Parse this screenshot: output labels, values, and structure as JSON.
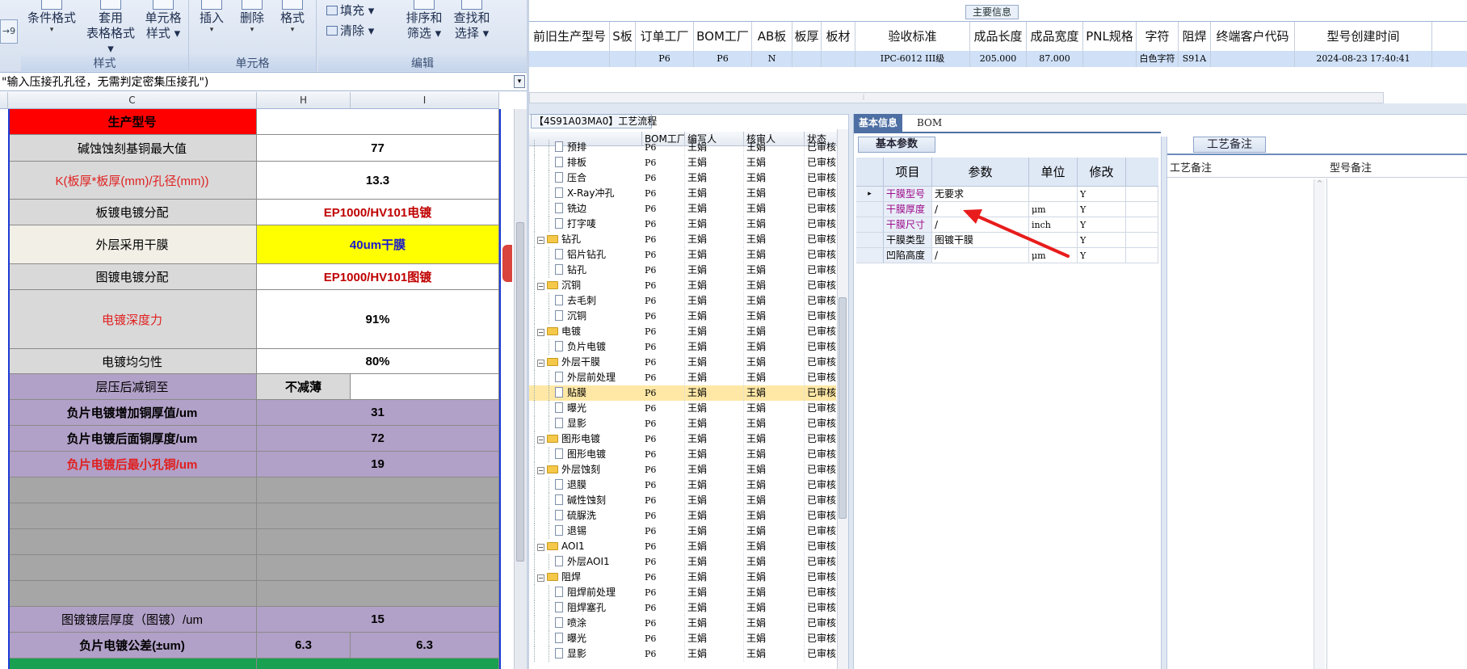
{
  "ribbon": {
    "cond_format": "条件格式",
    "table_format_1": "套用",
    "table_format_2": "表格格式",
    "cell_style_1": "单元格",
    "cell_style_2": "样式",
    "group_style": "样式",
    "insert": "插入",
    "delete": "删除",
    "format": "格式",
    "group_cells": "单元格",
    "fill": "填充",
    "clear": "清除",
    "sort_1": "排序和",
    "sort_2": "筛选",
    "find_1": "查找和",
    "find_2": "选择",
    "group_edit": "编辑"
  },
  "formula_bar": {
    "text": "\"输入压接孔孔径，无需判定密集压接孔\")"
  },
  "columns": {
    "c": "C",
    "h": "H",
    "i": "I"
  },
  "sheet": {
    "r1_label": "生产型号",
    "r2_label": "碱蚀蚀刻基铜最大值",
    "r2_value": "77",
    "r3_label": "K(板厚*板厚(mm)/孔径(mm))",
    "r3_value": "13.3",
    "r4_label": "板镀电镀分配",
    "r4_value": "EP1000/HV101电镀",
    "r5_label": "外层采用干膜",
    "r5_value": "40um干膜",
    "r6_label": "图镀电镀分配",
    "r6_value": "EP1000/HV101图镀",
    "r7_label": "电镀深度力",
    "r7_value": "91%",
    "r8_label": "电镀均匀性",
    "r8_value": "80%",
    "r9_label": "层压后减铜至",
    "r9_value": "不减薄",
    "r10_label": "负片电镀增加铜厚值/um",
    "r10_value": "31",
    "r11_label": "负片电镀后面铜厚度/um",
    "r11_value": "72",
    "r12_label": "负片电镀后最小孔铜/um",
    "r12_value": "19",
    "r13_label": "图镀镀层厚度（图镀）/um",
    "r13_value": "15",
    "r14_label": "负片电镀公差(±um)",
    "r14_value_h": "6.3",
    "r14_value_i": "6.3"
  },
  "main_info_tab": "主要信息",
  "top_grid": {
    "headers": [
      "前旧生产型号",
      "S板",
      "订单工厂",
      "BOM工厂",
      "AB板",
      "板厚",
      "板材",
      "验收标准",
      "成品长度",
      "成品宽度",
      "PNL规格",
      "字符",
      "阻焊",
      "终端客户代码",
      "型号创建时间"
    ],
    "row": [
      "",
      "",
      "P6",
      "P6",
      "N",
      "",
      "",
      "IPC-6012 III级",
      "205.000",
      "87.000",
      "",
      "白色字符",
      "S91A",
      "",
      "2024-08-23 17:40:41"
    ]
  },
  "tree": {
    "tab_title": "【4S91A03MA0】工艺流程",
    "headers": {
      "bom": "BOM工厂",
      "author": "编写人",
      "reviewer": "核审人",
      "status": "状态"
    },
    "rows": [
      {
        "name": "预排",
        "level": 2,
        "folder": false,
        "bom": "P6",
        "author": "王娟",
        "reviewer": "王娟",
        "status": "已审核"
      },
      {
        "name": "排板",
        "level": 2,
        "folder": false,
        "bom": "P6",
        "author": "王娟",
        "reviewer": "王娟",
        "status": "已审核"
      },
      {
        "name": "压合",
        "level": 2,
        "folder": false,
        "bom": "P6",
        "author": "王娟",
        "reviewer": "王娟",
        "status": "已审核"
      },
      {
        "name": "X-Ray冲孔",
        "level": 2,
        "folder": false,
        "bom": "P6",
        "author": "王娟",
        "reviewer": "王娟",
        "status": "已审核"
      },
      {
        "name": "铣边",
        "level": 2,
        "folder": false,
        "bom": "P6",
        "author": "王娟",
        "reviewer": "王娟",
        "status": "已审核"
      },
      {
        "name": "打字唛",
        "level": 2,
        "folder": false,
        "bom": "P6",
        "author": "王娟",
        "reviewer": "王娟",
        "status": "已审核"
      },
      {
        "name": "钻孔",
        "level": 1,
        "folder": true,
        "bom": "P6",
        "author": "王娟",
        "reviewer": "王娟",
        "status": "已审核"
      },
      {
        "name": "铝片钻孔",
        "level": 2,
        "folder": false,
        "bom": "P6",
        "author": "王娟",
        "reviewer": "王娟",
        "status": "已审核"
      },
      {
        "name": "钻孔",
        "level": 2,
        "folder": false,
        "bom": "P6",
        "author": "王娟",
        "reviewer": "王娟",
        "status": "已审核"
      },
      {
        "name": "沉铜",
        "level": 1,
        "folder": true,
        "bom": "P6",
        "author": "王娟",
        "reviewer": "王娟",
        "status": "已审核"
      },
      {
        "name": "去毛刺",
        "level": 2,
        "folder": false,
        "bom": "P6",
        "author": "王娟",
        "reviewer": "王娟",
        "status": "已审核"
      },
      {
        "name": "沉铜",
        "level": 2,
        "folder": false,
        "bom": "P6",
        "author": "王娟",
        "reviewer": "王娟",
        "status": "已审核"
      },
      {
        "name": "电镀",
        "level": 1,
        "folder": true,
        "bom": "P6",
        "author": "王娟",
        "reviewer": "王娟",
        "status": "已审核"
      },
      {
        "name": "负片电镀",
        "level": 2,
        "folder": false,
        "bom": "P6",
        "author": "王娟",
        "reviewer": "王娟",
        "status": "已审核"
      },
      {
        "name": "外层干膜",
        "level": 1,
        "folder": true,
        "bom": "P6",
        "author": "王娟",
        "reviewer": "王娟",
        "status": "已审核"
      },
      {
        "name": "外层前处理",
        "level": 2,
        "folder": false,
        "bom": "P6",
        "author": "王娟",
        "reviewer": "王娟",
        "status": "已审核"
      },
      {
        "name": "贴膜",
        "level": 2,
        "folder": false,
        "bom": "P6",
        "author": "王娟",
        "reviewer": "王娟",
        "status": "已审核",
        "selected": true
      },
      {
        "name": "曝光",
        "level": 2,
        "folder": false,
        "bom": "P6",
        "author": "王娟",
        "reviewer": "王娟",
        "status": "已审核"
      },
      {
        "name": "显影",
        "level": 2,
        "folder": false,
        "bom": "P6",
        "author": "王娟",
        "reviewer": "王娟",
        "status": "已审核"
      },
      {
        "name": "图形电镀",
        "level": 1,
        "folder": true,
        "bom": "P6",
        "author": "王娟",
        "reviewer": "王娟",
        "status": "已审核"
      },
      {
        "name": "图形电镀",
        "level": 2,
        "folder": false,
        "bom": "P6",
        "author": "王娟",
        "reviewer": "王娟",
        "status": "已审核"
      },
      {
        "name": "外层蚀刻",
        "level": 1,
        "folder": true,
        "bom": "P6",
        "author": "王娟",
        "reviewer": "王娟",
        "status": "已审核"
      },
      {
        "name": "退膜",
        "level": 2,
        "folder": false,
        "bom": "P6",
        "author": "王娟",
        "reviewer": "王娟",
        "status": "已审核"
      },
      {
        "name": "碱性蚀刻",
        "level": 2,
        "folder": false,
        "bom": "P6",
        "author": "王娟",
        "reviewer": "王娟",
        "status": "已审核"
      },
      {
        "name": "硫脲洗",
        "level": 2,
        "folder": false,
        "bom": "P6",
        "author": "王娟",
        "reviewer": "王娟",
        "status": "已审核"
      },
      {
        "name": "退锡",
        "level": 2,
        "folder": false,
        "bom": "P6",
        "author": "王娟",
        "reviewer": "王娟",
        "status": "已审核"
      },
      {
        "name": "AOI1",
        "level": 1,
        "folder": true,
        "bom": "P6",
        "author": "王娟",
        "reviewer": "王娟",
        "status": "已审核"
      },
      {
        "name": "外层AOI1",
        "level": 2,
        "folder": false,
        "bom": "P6",
        "author": "王娟",
        "reviewer": "王娟",
        "status": "已审核"
      },
      {
        "name": "阻焊",
        "level": 1,
        "folder": true,
        "bom": "P6",
        "author": "王娟",
        "reviewer": "王娟",
        "status": "已审核"
      },
      {
        "name": "阻焊前处理",
        "level": 2,
        "folder": false,
        "bom": "P6",
        "author": "王娟",
        "reviewer": "王娟",
        "status": "已审核"
      },
      {
        "name": "阻焊塞孔",
        "level": 2,
        "folder": false,
        "bom": "P6",
        "author": "王娟",
        "reviewer": "王娟",
        "status": "已审核"
      },
      {
        "name": "喷涂",
        "level": 2,
        "folder": false,
        "bom": "P6",
        "author": "王娟",
        "reviewer": "王娟",
        "status": "已审核"
      },
      {
        "name": "曝光",
        "level": 2,
        "folder": false,
        "bom": "P6",
        "author": "王娟",
        "reviewer": "王娟",
        "status": "已审核"
      },
      {
        "name": "显影",
        "level": 2,
        "folder": false,
        "bom": "P6",
        "author": "王娟",
        "reviewer": "王娟",
        "status": "已审核"
      }
    ]
  },
  "basic_info": {
    "tab_basic": "基本信息",
    "tab_bom": "BOM",
    "param_tab": "基本参数",
    "headers": {
      "item": "项目",
      "param": "参数",
      "unit": "单位",
      "modify": "修改"
    },
    "rows": [
      {
        "item": "干膜型号",
        "param": "无要求",
        "unit": "",
        "modify": "Y"
      },
      {
        "item": "干膜厚度",
        "param": "/",
        "unit": "μm",
        "modify": "Y"
      },
      {
        "item": "干膜尺寸",
        "param": "/",
        "unit": "inch",
        "modify": "Y"
      },
      {
        "item": "干膜类型",
        "param": "图镀干膜",
        "unit": "",
        "modify": "Y"
      },
      {
        "item": "凹陷高度",
        "param": "/",
        "unit": "μm",
        "modify": "Y"
      }
    ]
  },
  "remarks": {
    "tab": "工艺备注",
    "process_remark": "工艺备注",
    "model_remark": "型号备注"
  }
}
